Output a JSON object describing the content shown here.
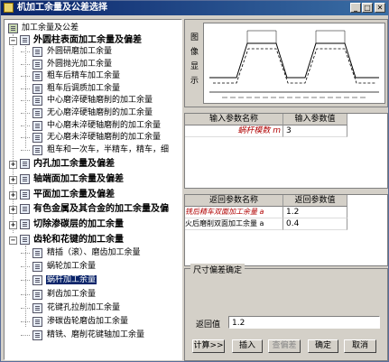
{
  "window": {
    "title": "机加工余量及公差选择"
  },
  "tree": {
    "root": "加工余量及公差",
    "group1": {
      "label": "外圆柱表面加工余量及偏差",
      "items": [
        "外圆研磨加工余量",
        "外圆抛光加工余量",
        "粗车后精车加工余量",
        "粗车后调质加工余量",
        "中心磨淬硬轴磨削的加工余量",
        "无心磨淬硬轴磨削的加工余量",
        "中心磨未淬硬轴磨削的加工余量",
        "无心磨未淬硬轴磨削的加工余量",
        "粗车和一次车，半精车，精车，细"
      ]
    },
    "collapsed": [
      "内孔加工余量及偏差",
      "轴端面加工余量及偏差",
      "平面加工余量及偏差",
      "有色金属及其合金的加工余量及偏",
      "切除渗碳层的加工余量"
    ],
    "group2": {
      "label": "齿轮和花键的加工余量",
      "items": [
        "精插（滚）、磨齿加工余量",
        "蜗轮加工余量",
        "蜗杆加工余量",
        "剃齿加工余量",
        "花键孔拉削加工余量",
        "渗碳齿轮磨齿加工余量",
        "精铣、磨削花键轴加工余量"
      ],
      "selected_index": 2
    }
  },
  "image_panel": {
    "label": "图像显示"
  },
  "input_table": {
    "headers": [
      "输入参数名称",
      "输入参数值"
    ],
    "rows": [
      {
        "name": "蜗杆模数 m",
        "value": "3"
      }
    ]
  },
  "output_table": {
    "headers": [
      "返回参数名称",
      "返回参数值"
    ],
    "rows": [
      {
        "name": "铣后精车双面加工余量 a",
        "value": "1.2"
      },
      {
        "name": "火后磨削双面加工余量 a",
        "value": "0.4"
      }
    ]
  },
  "tolerance": {
    "group_title": "尺寸偏差确定",
    "return_label": "返回值",
    "return_value": "1.2"
  },
  "buttons": {
    "calculate": "计算>>",
    "insert": "插入",
    "query_tolerance": "查偏差",
    "ok": "确定",
    "cancel": "取消"
  },
  "colors": {
    "title_bar": "#0a246a",
    "selection": "#0a246a",
    "highlight_text": "#b00000"
  }
}
